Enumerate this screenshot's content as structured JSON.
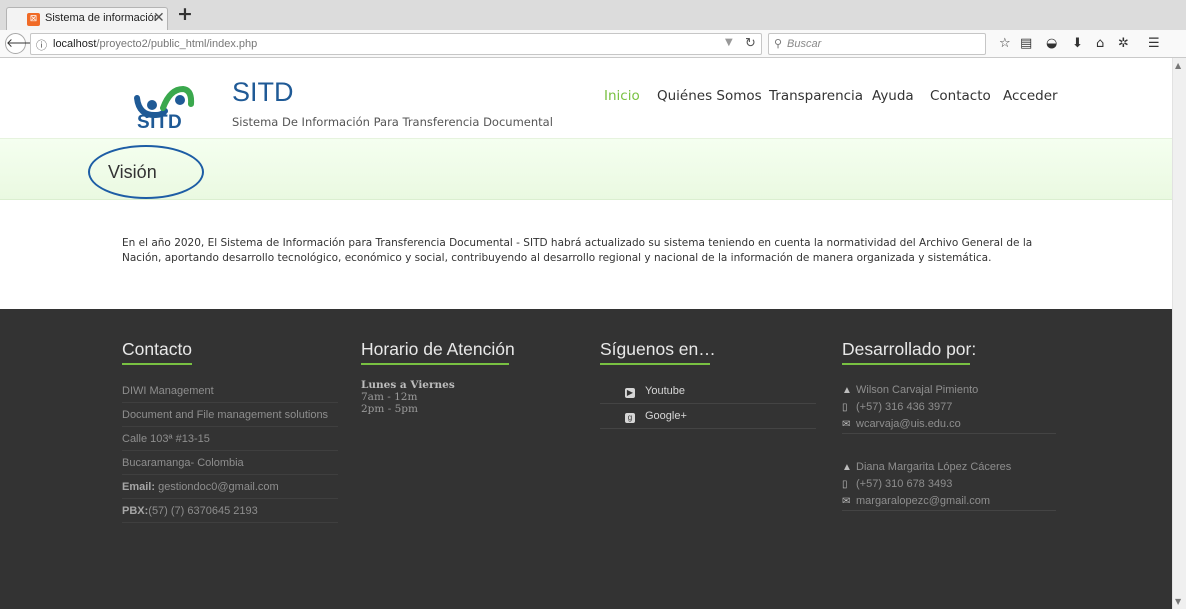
{
  "browser": {
    "tab_title": "Sistema de información par",
    "tab_close": "✕",
    "new_tab": "+",
    "url_host": "localhost",
    "url_path": "/proyecto2/public_html/index.php",
    "search_placeholder": "Buscar"
  },
  "header": {
    "logo_text": "SITD",
    "title": "SITD",
    "subtitle": "Sistema De Información Para Transferencia Documental",
    "nav": [
      {
        "label": "Inicio"
      },
      {
        "label": "Quiénes Somos"
      },
      {
        "label": "Transparencia"
      },
      {
        "label": "Ayuda"
      },
      {
        "label": "Contacto"
      },
      {
        "label": "Acceder"
      }
    ]
  },
  "page": {
    "section_title": "Visión",
    "body": "En el año 2020, El Sistema de Información para Transferencia Documental - SITD habrá actualizado su sistema teniendo en cuenta la normatividad del Archivo General de la Nación, aportando desarrollo tecnológico, económico y social, contribuyendo al desarrollo regional y nacional de la información de manera organizada y sistemática."
  },
  "footer": {
    "contact": {
      "heading": "Contacto",
      "rows": [
        {
          "text": "DIWI Management"
        },
        {
          "text": "Document and File management solutions"
        },
        {
          "text": "Calle 103ª #13-15"
        },
        {
          "text": "Bucaramanga- Colombia"
        },
        {
          "label": "Email:",
          "text": " gestiondoc0@gmail.com"
        },
        {
          "label": "PBX:",
          "text": "(57) (7) 6370645 2193"
        }
      ]
    },
    "schedule": {
      "heading": "Horario de Atención",
      "days": "Lunes a Viernes",
      "morning": "7am - 12m",
      "afternoon": "2pm - 5pm"
    },
    "social": {
      "heading": "Síguenos en…",
      "links": [
        {
          "label": "Youtube"
        },
        {
          "label": "Google+"
        }
      ]
    },
    "developers": {
      "heading": "Desarrollado por:",
      "people": [
        {
          "name": "Wilson Carvajal Pimiento",
          "phone": "(+57) 316 436 3977",
          "email": "wcarvaja@uis.edu.co"
        },
        {
          "name": "Diana Margarita López Cáceres",
          "phone": "(+57) 310 678 3493",
          "email": "margaralopezc@gmail.com"
        }
      ]
    }
  },
  "colors": {
    "accent_green": "#79c142",
    "brand_blue": "#1f5a96",
    "footer_bg": "#333333"
  }
}
